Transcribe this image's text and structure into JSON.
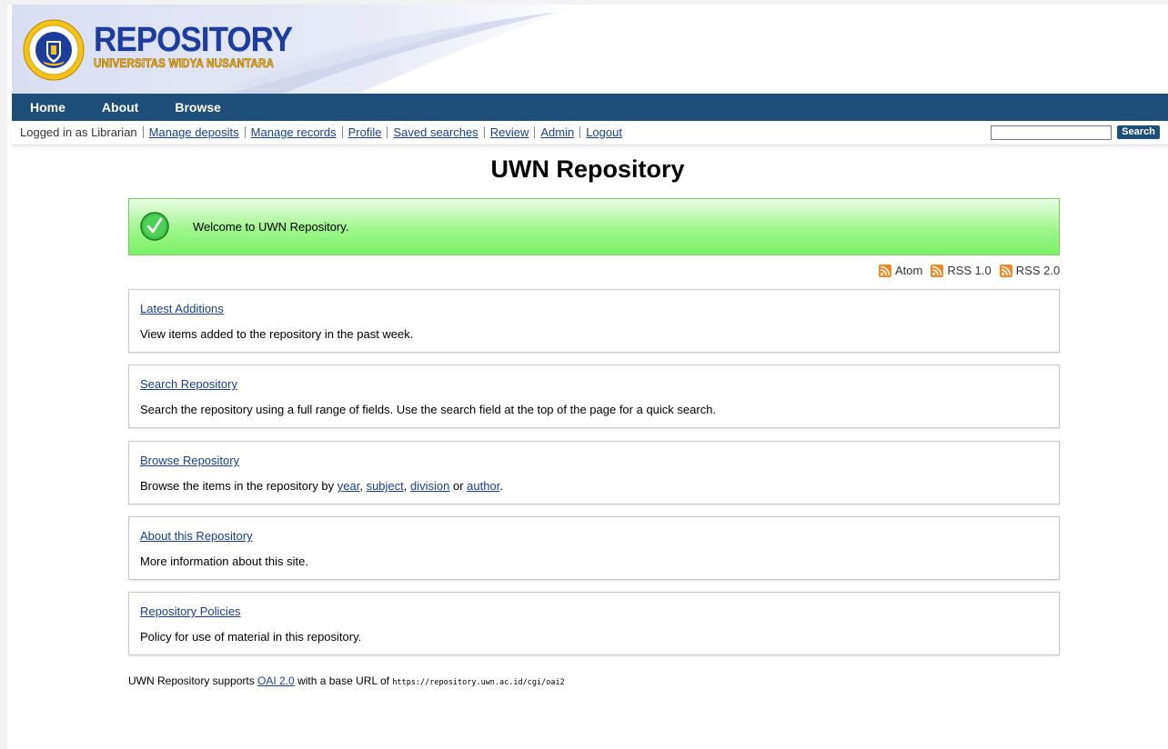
{
  "header": {
    "logo_title": "REPOSITORY",
    "logo_subtitle": "UNIVERSITAS WIDYA NUSANTARA",
    "brand_blue": "#1d3d9c",
    "brand_gold": "#f5c21a"
  },
  "nav": {
    "items": [
      {
        "label": "Home"
      },
      {
        "label": "About"
      },
      {
        "label": "Browse"
      }
    ],
    "bg": "#1d4e79"
  },
  "userbar": {
    "logged_in": "Logged in as Librarian",
    "links": [
      "Manage deposits",
      "Manage records",
      "Profile",
      "Saved searches",
      "Review",
      "Admin",
      "Logout"
    ],
    "search_placeholder": "",
    "search_button": "Search"
  },
  "main": {
    "title": "UWN Repository",
    "welcome": "Welcome to UWN Repository.",
    "feeds": [
      "Atom",
      "RSS 1.0",
      "RSS 2.0"
    ],
    "panels": [
      {
        "title": "Latest Additions",
        "desc": "View items added to the repository in the past week."
      },
      {
        "title": "Search Repository",
        "desc": "Search the repository using a full range of fields. Use the search field at the top of the page for a quick search."
      },
      {
        "title": "Browse Repository",
        "desc_prefix": "Browse the items in the repository by ",
        "links": [
          "year",
          "subject",
          "division",
          "author"
        ],
        "sep1": ", ",
        "sep2": ", ",
        "sep3": " or ",
        "desc_suffix": "."
      },
      {
        "title": "About this Repository",
        "desc": "More information about this site."
      },
      {
        "title": "Repository Policies",
        "desc": "Policy for use of material in this repository."
      }
    ]
  },
  "footer": {
    "prefix": "UWN Repository supports ",
    "oai_link": "OAI 2.0",
    "middle": " with a base URL of ",
    "url": "https://repository.uwn.ac.id/cgi/oai2"
  }
}
